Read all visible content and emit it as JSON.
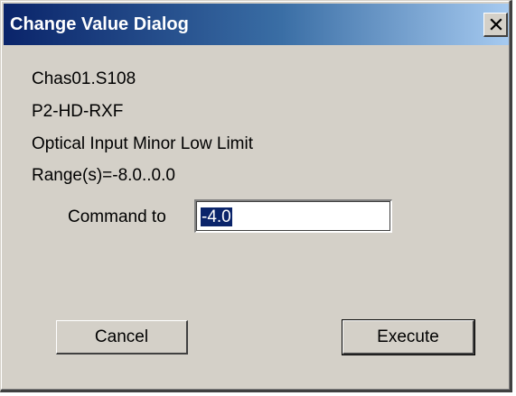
{
  "window": {
    "title": "Change Value Dialog",
    "title_gradient_start": "#0a246a",
    "title_gradient_end": "#a6caf0",
    "face_color": "#d4d0c8"
  },
  "info": {
    "line1": "Chas01.S108",
    "line2": "P2-HD-RXF",
    "line3": "Optical Input Minor Low Limit",
    "line4": "Range(s)=-8.0..0.0"
  },
  "command": {
    "label": "Command to",
    "value": "-4.0"
  },
  "buttons": {
    "cancel_label": "Cancel",
    "execute_label": "Execute"
  },
  "icons": {
    "close": "close-icon"
  }
}
